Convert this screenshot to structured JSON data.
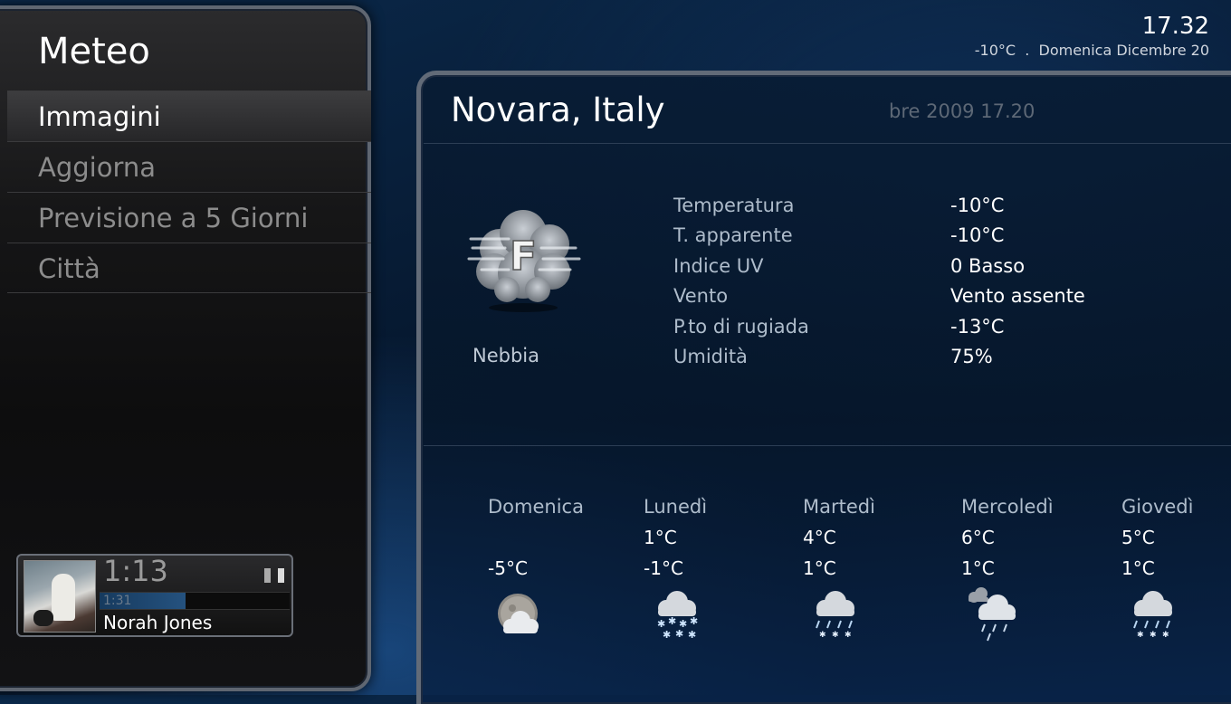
{
  "menu": {
    "title": "Meteo",
    "items": [
      {
        "label": "Immagini",
        "selected": true
      },
      {
        "label": "Aggiorna",
        "selected": false
      },
      {
        "label": "Previsione a 5 Giorni",
        "selected": false
      },
      {
        "label": "Città",
        "selected": false
      }
    ]
  },
  "now_playing": {
    "remaining_time": "1:13",
    "elapsed_time": "1:31",
    "progress_fraction": 0.45,
    "artist": "Norah Jones",
    "state_icon": "pause-icon"
  },
  "header": {
    "clock": "17.32",
    "status": "-10°C  .  Domenica Dicembre 20"
  },
  "weather": {
    "location": "Novara, Italy",
    "updated": "bre 2009 17.20",
    "condition": "Nebbia",
    "condition_icon": "fog-icon",
    "details": [
      {
        "label": "Temperatura",
        "value": "-10°C"
      },
      {
        "label": "T. apparente",
        "value": "-10°C"
      },
      {
        "label": "Indice UV",
        "value": "0 Basso"
      },
      {
        "label": "Vento",
        "value": "Vento assente"
      },
      {
        "label": "P.to di rugiada",
        "value": "-13°C"
      },
      {
        "label": "Umidità",
        "value": "75%"
      }
    ]
  },
  "forecast": [
    {
      "day": "Domenica",
      "high": "",
      "low": "-5°C",
      "icon": "partly-cloudy-night-icon"
    },
    {
      "day": "Lunedì",
      "high": "1°C",
      "low": "-1°C",
      "icon": "snow-icon"
    },
    {
      "day": "Martedì",
      "high": "4°C",
      "low": "1°C",
      "icon": "sleet-icon"
    },
    {
      "day": "Mercoledì",
      "high": "6°C",
      "low": "1°C",
      "icon": "rain-showers-icon"
    },
    {
      "day": "Giovedì",
      "high": "5°C",
      "low": "1°C",
      "icon": "sleet-icon"
    }
  ]
}
